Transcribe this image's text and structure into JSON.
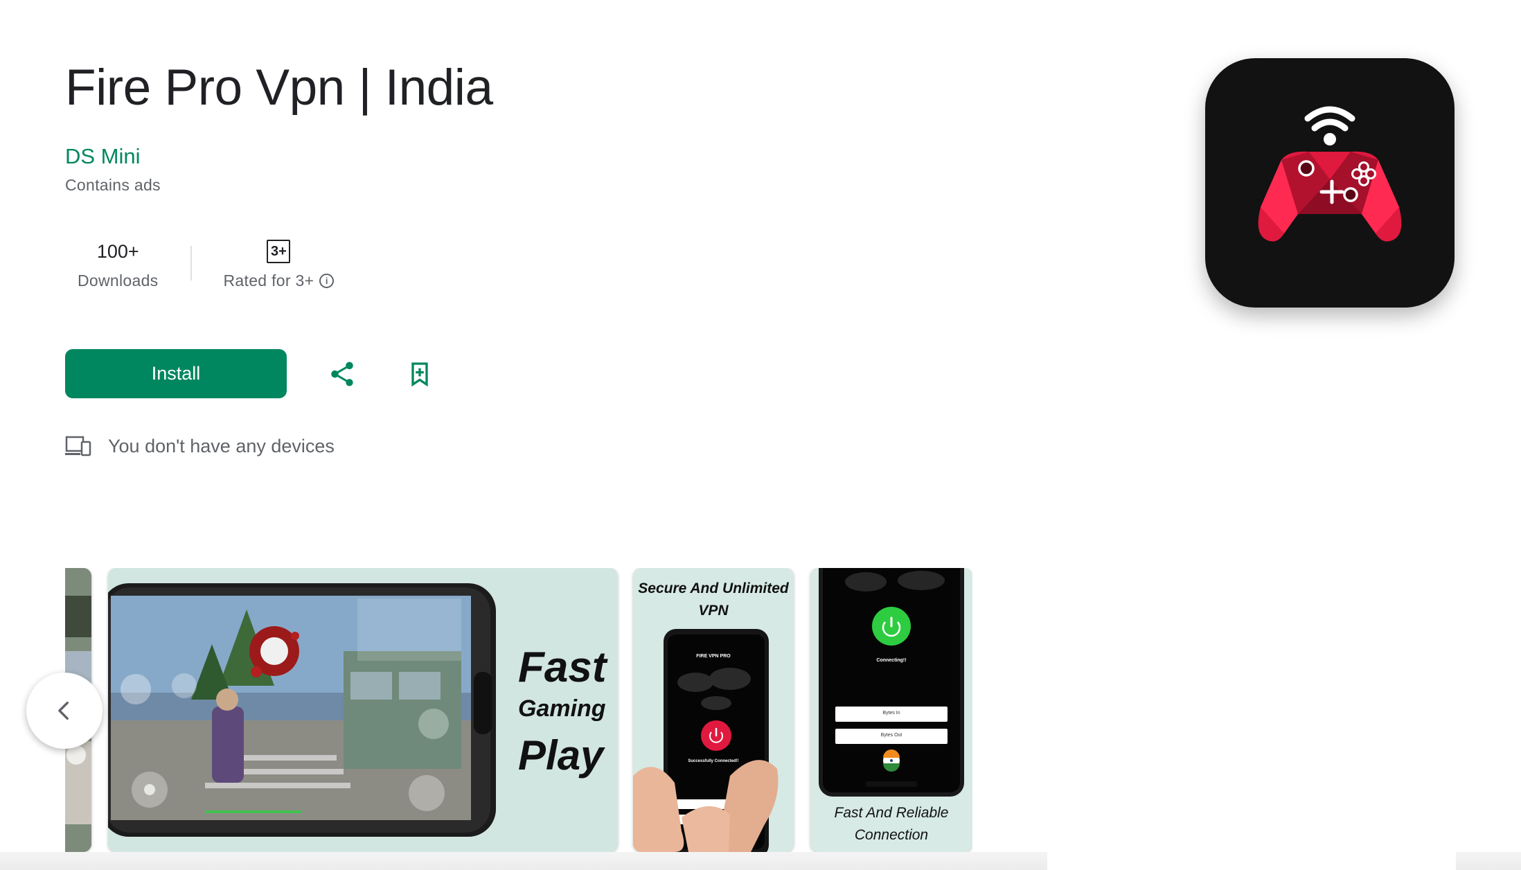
{
  "app": {
    "title": "Fire Pro Vpn | India",
    "developer": "DS Mini",
    "ads_notice": "Contains ads"
  },
  "stats": {
    "downloads_value": "100+",
    "downloads_label": "Downloads",
    "rating_badge": "3+",
    "rating_label": "Rated for 3+"
  },
  "actions": {
    "install_label": "Install"
  },
  "devices": {
    "message": "You don't have any devices"
  },
  "icons": {
    "share": "share-icon",
    "wishlist": "bookmark-add-icon",
    "devices": "devices-icon",
    "info": "info-icon",
    "prev": "chevron-left-icon",
    "app": "gamepad-wifi-icon"
  },
  "screenshots": {
    "shot1": {
      "line1": "Fast",
      "line2": "Gaming",
      "line3": "Play"
    },
    "shot2": {
      "line1": "Secure And Unlimited",
      "line2": "VPN",
      "screen_title": "FIRE VPN PRO",
      "status": "Successfully Connected!!"
    },
    "shot3": {
      "line1": "Fast And Reliable",
      "line2": "Connection",
      "status": "Connecting!!",
      "bytes_in": "Bytes In",
      "bytes_out": "Bytes Out"
    }
  },
  "colors": {
    "accent": "#01875f",
    "icon_bg": "#121212",
    "gamepad_red": "#e0193f"
  }
}
